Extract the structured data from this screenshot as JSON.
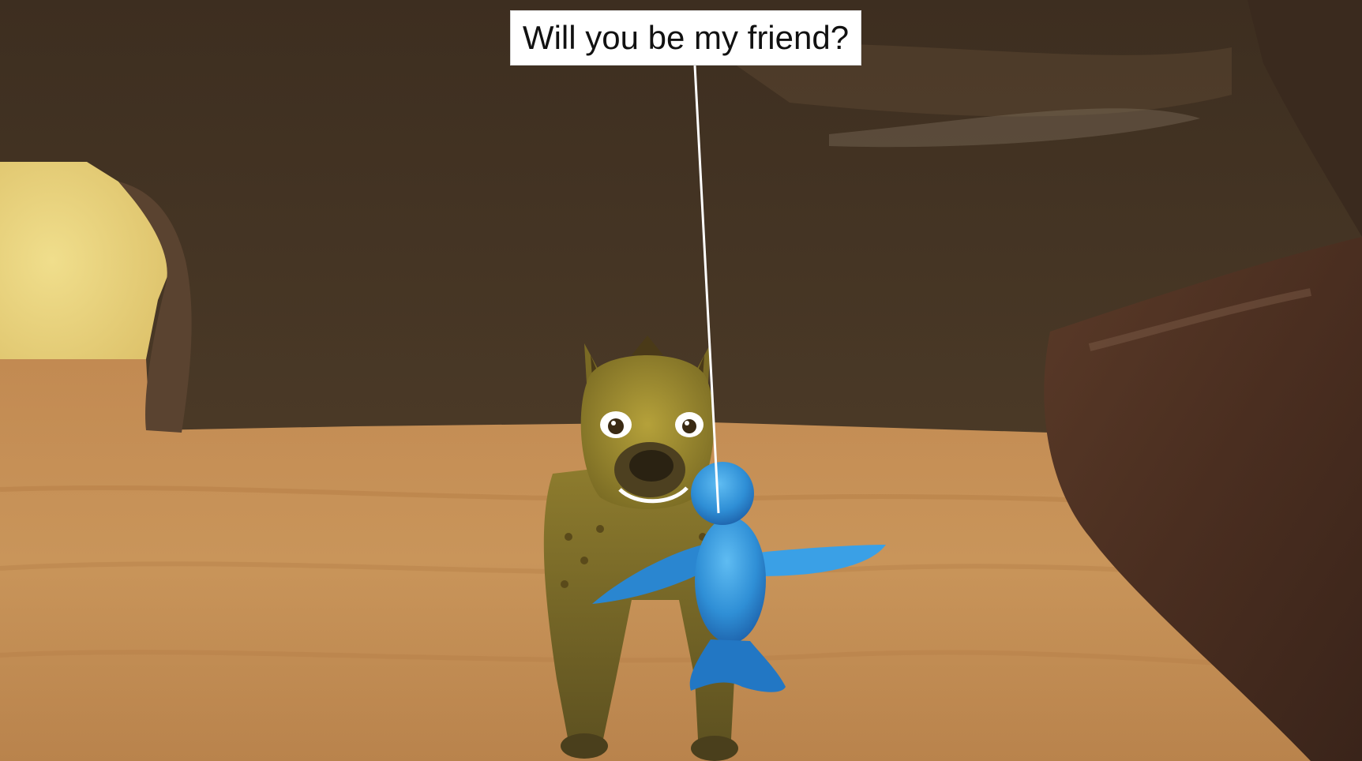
{
  "scene": {
    "location": "desert-cave",
    "characters": [
      "hyena",
      "blue-bird"
    ]
  },
  "speech_bubble": {
    "text": "Will you be my friend?"
  },
  "colors": {
    "cave_rock": "#4a3826",
    "sand": "#c08a50",
    "sky_glow": "#e9d078",
    "hyena_fur": "#8a7a2a",
    "bird_blue": "#3a9ee0",
    "bubble_bg": "#ffffff"
  }
}
